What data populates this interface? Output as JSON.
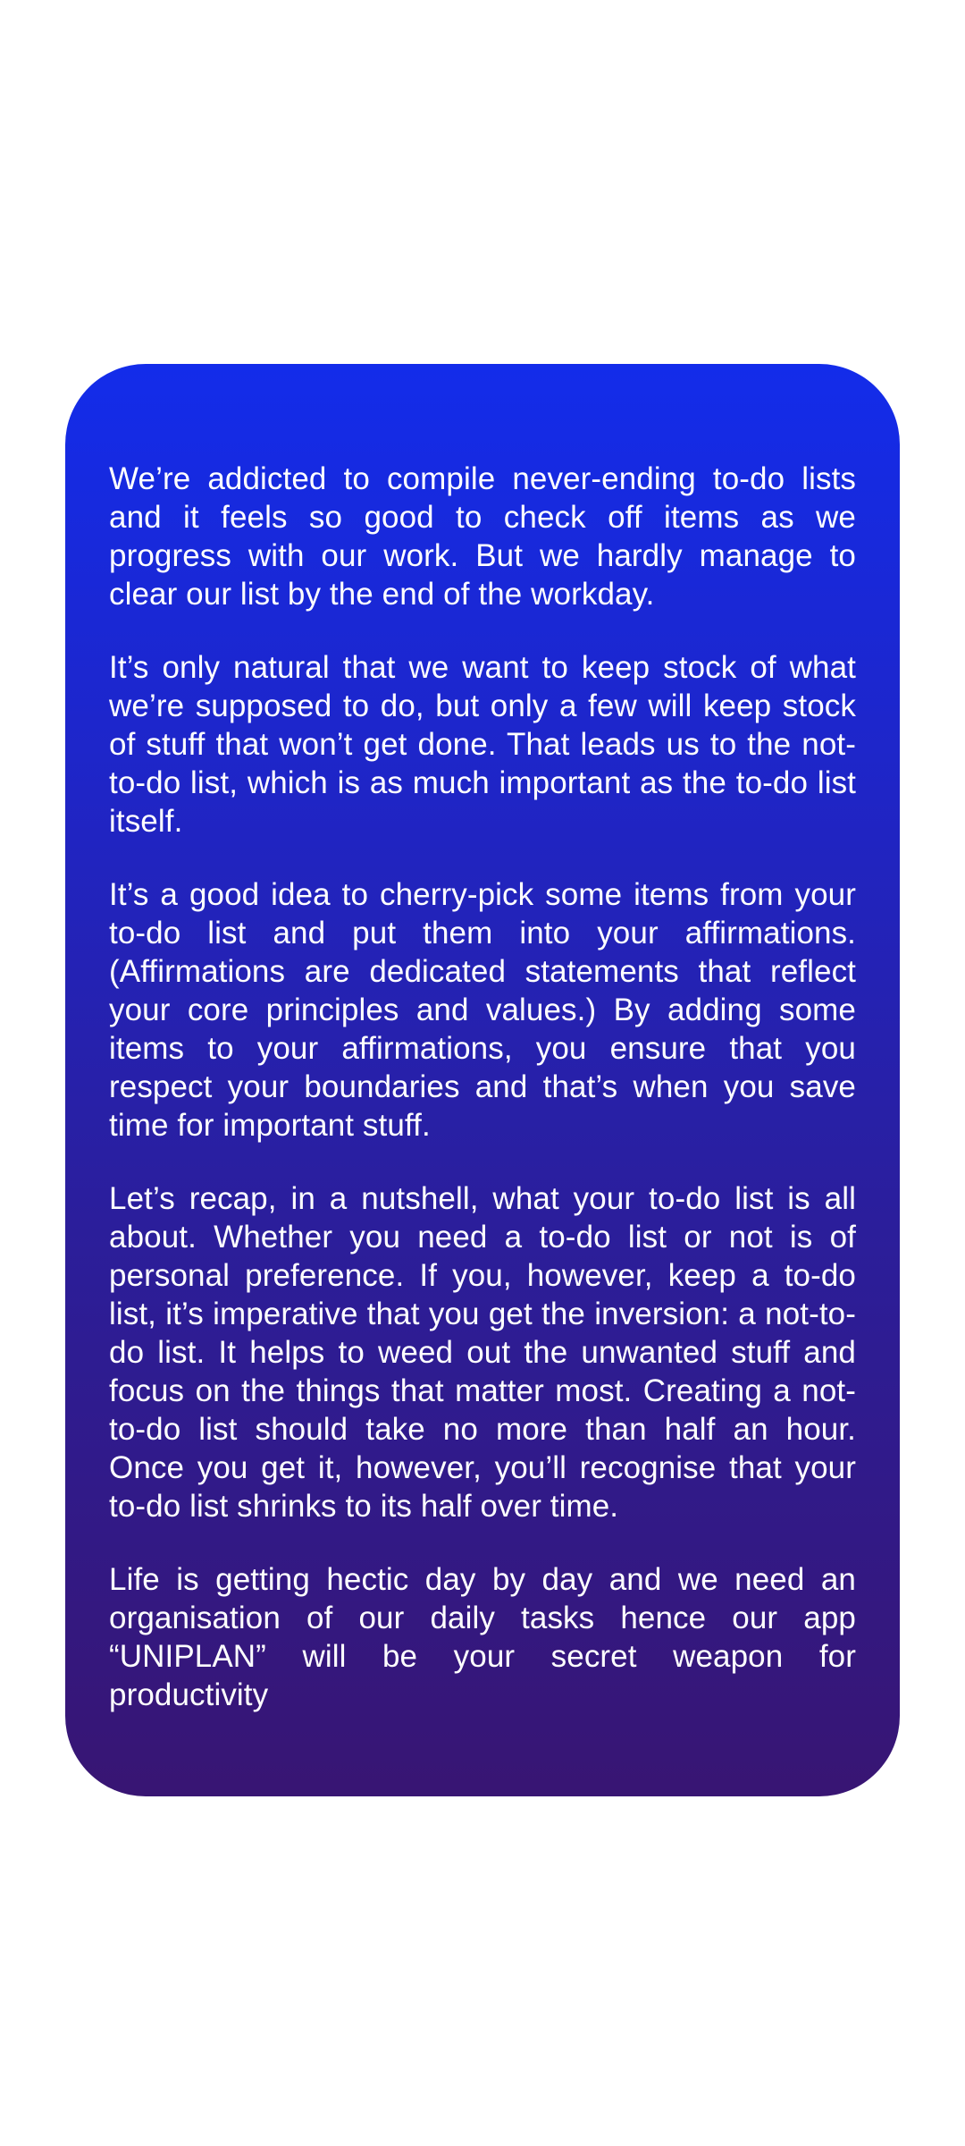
{
  "article": {
    "paragraphs": [
      "We’re addicted to compile never-ending to-do lists and it feels so good to check off items as we progress with our work. But we hardly manage to clear our list by the end of the workday.",
      "It’s only natural that we want to keep stock of what we’re supposed to do, but only a few will keep stock of stuff that won’t get done. That leads us to the not-to-do list, which is as much important as the to-do list itself.",
      "It’s a good idea to cherry-pick some items from your to-do list and put them into your affirmations. (Affirmations are dedicated statements that reflect your core principles and values.) By adding some items to your affirmations, you ensure that you respect your boundaries and that’s when you save time for important stuff.",
      "Let’s recap, in a nutshell, what your to-do list is all about. Whether you need a to-do list or not is of personal preference. If you, however, keep a to-do list, it’s imperative that you get the inversion: a not-to-do list. It helps to weed out the unwanted stuff and focus on the things that matter most. Creating a not-to-do list should take no more than half an hour. Once you get it, however, you’ll recognise that your to-do list shrinks to its half over time.",
      "Life is getting hectic day by day and we need an organisation of our daily tasks hence our app “UNIPLAN” will be your secret weapon for productivity"
    ]
  },
  "colors": {
    "background": "#ffffff",
    "card_gradient_top": "#132cea",
    "card_gradient_bottom": "#381573",
    "text": "#ffffff"
  }
}
